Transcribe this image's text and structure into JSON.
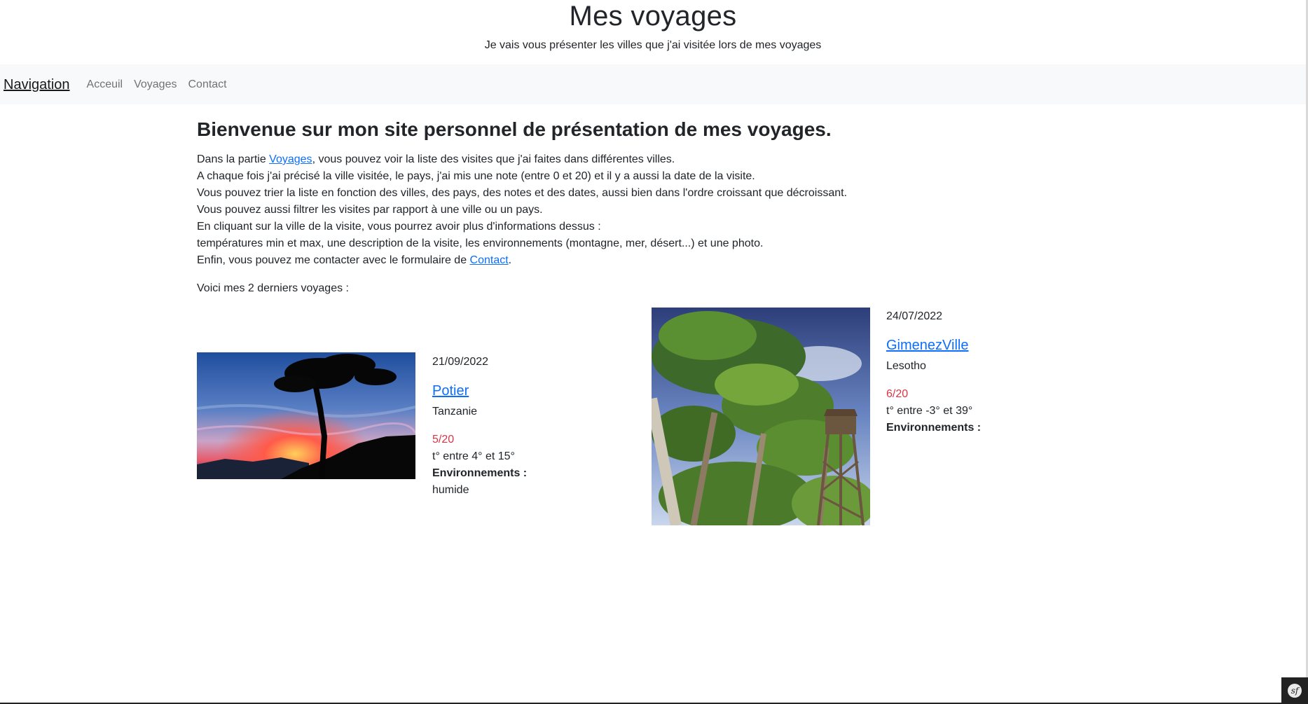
{
  "header": {
    "title": "Mes voyages",
    "subtitle": "Je vais vous présenter les villes que j'ai visitée lors de mes voyages"
  },
  "nav": {
    "brand": "Navigation",
    "links": [
      "Acceuil",
      "Voyages",
      "Contact"
    ]
  },
  "main": {
    "title": "Bienvenue sur mon site personnel de présentation de mes voyages.",
    "intro": {
      "line1_prefix": "Dans la partie ",
      "line1_link": "Voyages",
      "line1_suffix": ", vous pouvez voir la liste des visites que j'ai faites dans différentes villes.",
      "line2": "A chaque fois j'ai précisé la ville visitée, le pays, j'ai mis une note (entre 0 et 20) et il y a aussi la date de la visite.",
      "line3": "Vous pouvez trier la liste en fonction des villes, des pays, des notes et des dates, aussi bien dans l'ordre croissant que décroissant.",
      "line4": "Vous pouvez aussi filtrer les visites par rapport à une ville ou un pays.",
      "line5": "En cliquant sur la ville de la visite, vous pourrez avoir plus d'informations dessus :",
      "line6": "températures min et max, une description de la visite, les environnements (montagne, mer, désert...) et une photo.",
      "line7_prefix": "Enfin, vous pouvez me contacter avec le formulaire de ",
      "line7_link": "Contact",
      "line7_suffix": "."
    },
    "latest_label": "Voici mes 2 derniers voyages :"
  },
  "trips": [
    {
      "date": "21/09/2022",
      "city": "Potier",
      "country": "Tanzanie",
      "note": "5/20",
      "temps": "t° entre 4° et 15°",
      "env_label": "Environnements :",
      "environments": "humide",
      "photo_icon": "sunset-tree-photo"
    },
    {
      "date": "24/07/2022",
      "city": "GimenezVille",
      "country": "Lesotho",
      "note": "6/20",
      "temps": "t° entre -3° et 39°",
      "env_label": "Environnements :",
      "environments": "",
      "photo_icon": "forest-tower-photo"
    }
  ],
  "colors": {
    "link": "#0d6efd",
    "note": "#dc3545",
    "navbar_bg": "#f8f9fa",
    "text": "#212529"
  },
  "toolbar": {
    "icon": "symfony-icon"
  }
}
